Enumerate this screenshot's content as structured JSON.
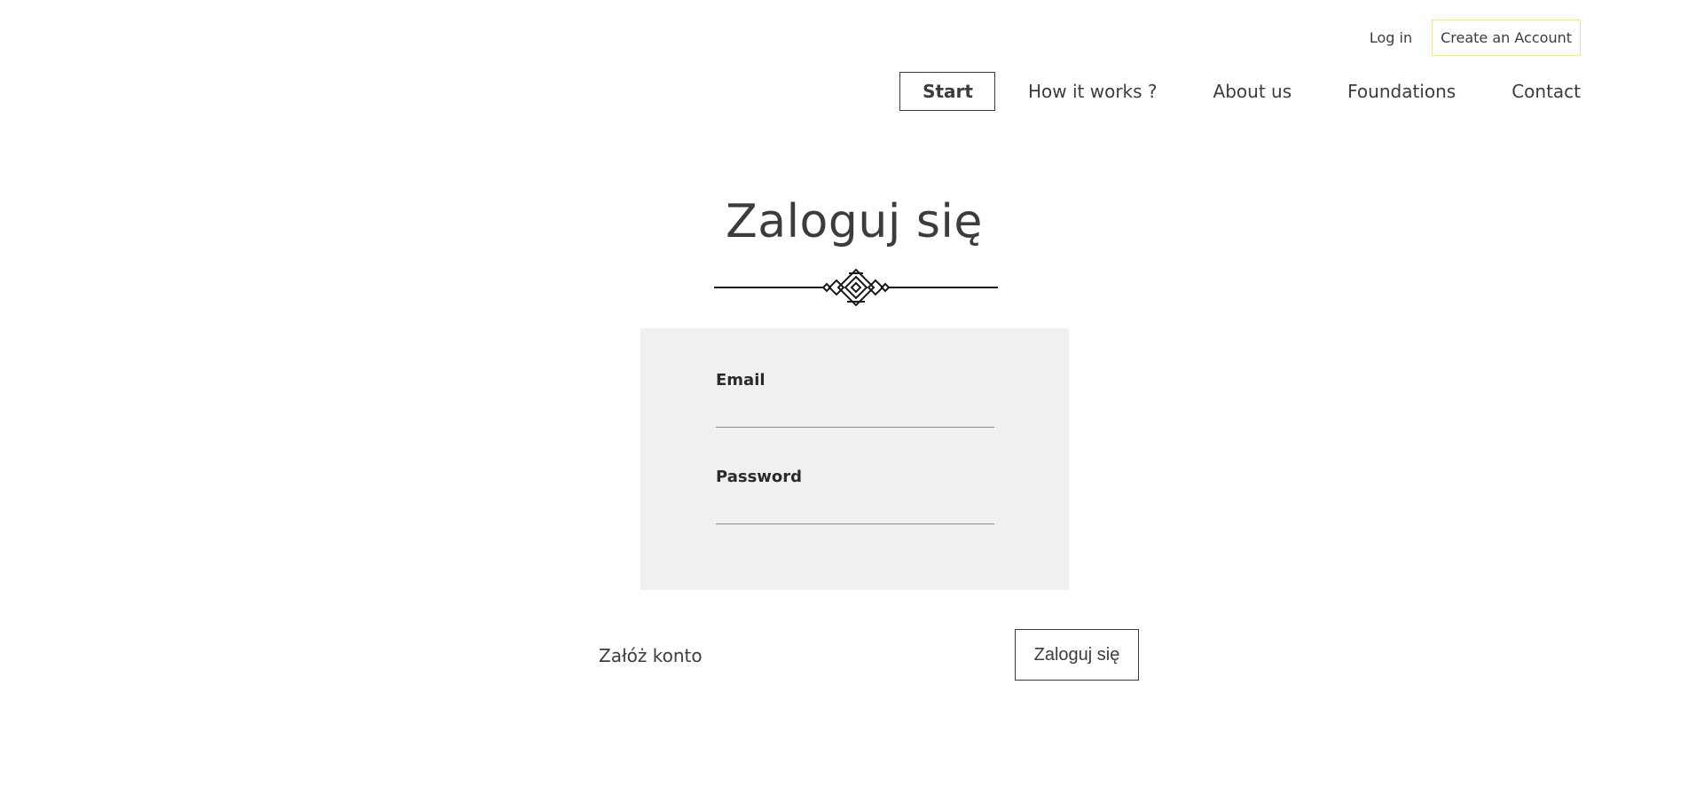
{
  "account": {
    "login_label": "Log in",
    "register_label": "Create an Account"
  },
  "nav": {
    "items": [
      {
        "label": "Start",
        "active": true
      },
      {
        "label": "How it works ?"
      },
      {
        "label": "About us"
      },
      {
        "label": "Foundations"
      },
      {
        "label": "Contact"
      }
    ]
  },
  "login": {
    "title": "Zaloguj się",
    "decoration_icon": "ornament-divider-icon",
    "email_label": "Email",
    "email_value": "",
    "password_label": "Password",
    "password_value": "",
    "register_link": "Załóż konto",
    "submit_label": "Zaloguj się"
  },
  "colors": {
    "text": "#3c3c3c",
    "panel_bg": "#eff0f0",
    "account_border": "#f0e4a0"
  }
}
